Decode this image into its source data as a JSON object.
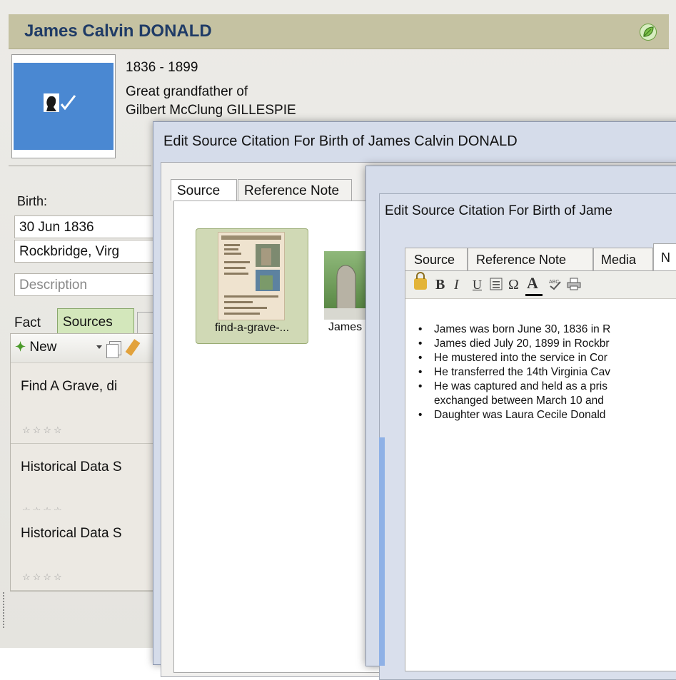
{
  "person": {
    "name": "James Calvin DONALD",
    "dates": "1836 - 1899",
    "relation_line1": "Great grandfather of",
    "relation_line2": "Gilbert McClung GILLESPIE",
    "birth_label": "Birth:",
    "birth_date": "30 Jun 1836",
    "birth_place": "Rockbridge, Virg",
    "birth_description": "Description"
  },
  "tabs": {
    "fact": "Fact",
    "sources": "Sources"
  },
  "sources_toolbar": {
    "new_label": "New"
  },
  "sources": [
    {
      "title": "Find A Grave, di",
      "stars": "☆☆☆☆"
    },
    {
      "title": "Historical Data S",
      "stars": "☆☆☆☆"
    },
    {
      "title": "Historical Data S",
      "stars": "☆☆☆☆"
    }
  ],
  "dialog1": {
    "title": "Edit Source Citation For Birth of James Calvin DONALD",
    "tab_source": "Source",
    "tab_reference_note": "Reference Note",
    "media": [
      {
        "label": "find-a-grave-..."
      },
      {
        "label": "James"
      }
    ]
  },
  "dialog2": {
    "title": "Edit Source Citation For Birth of Jame",
    "tab_source": "Source",
    "tab_reference_note": "Reference Note",
    "tab_media": "Media",
    "tab_notes": "N",
    "toolbar": {
      "bold": "B",
      "italic": "I",
      "underline": "U",
      "omega": "Ω",
      "font_color": "A"
    },
    "notes": [
      "James was born June 30, 1836 in R",
      "James died July 20, 1899 in Rockbr",
      "He mustered into the service in Cor",
      "He transferred the 14th Virginia Cav",
      "He was captured and held as a pris",
      "exchanged between March 10 and",
      "Daughter was Laura Cecile Donald"
    ]
  },
  "colors": {
    "name_bar": "#c5c2a2",
    "name_text": "#1f3b66",
    "photo_bg": "#4a88d2",
    "sources_tab": "#d3e7bb",
    "dialog_frame": "#d5dcea"
  }
}
